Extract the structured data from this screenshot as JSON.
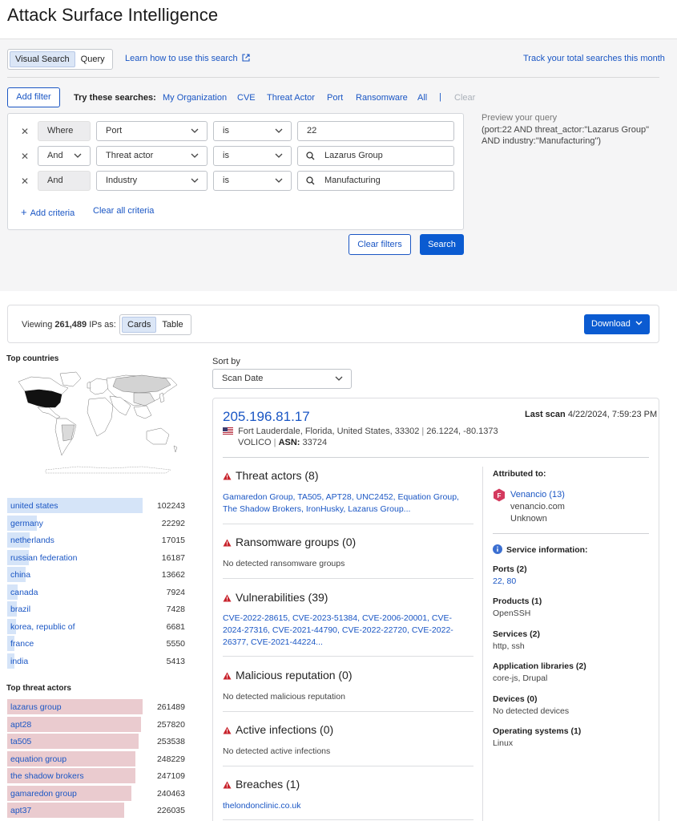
{
  "page": {
    "title": "Attack Surface Intelligence"
  },
  "search_mode": {
    "visual": "Visual Search",
    "query": "Query",
    "selected": "Visual Search"
  },
  "links": {
    "learn": "Learn how to use this search",
    "track": "Track your total searches this month"
  },
  "filters": {
    "add_filter": "Add filter",
    "try_label": "Try these searches:",
    "suggestions": [
      "My Organization",
      "CVE",
      "Threat Actor",
      "Port",
      "Ransomware",
      "All"
    ],
    "separator": "|",
    "clear": "Clear",
    "criteria": [
      {
        "connector": "Where",
        "field": "Port",
        "operator": "is",
        "value": "22"
      },
      {
        "connector": "And",
        "field": "Threat actor",
        "operator": "is",
        "value": "Lazarus Group"
      },
      {
        "connector": "And",
        "field": "Industry",
        "operator": "is",
        "value": "Manufacturing"
      }
    ],
    "add_criteria": "Add criteria",
    "clear_all_criteria": "Clear all criteria",
    "clear_filters": "Clear filters",
    "search": "Search"
  },
  "preview": {
    "label": "Preview your query",
    "query": "(port:22 AND threat_actor:\"Lazarus Group\" AND industry:\"Manufacturing\")"
  },
  "results": {
    "viewing_prefix": "Viewing",
    "count": "261,489",
    "viewing_suffix": "IPs as:",
    "views": [
      "Cards",
      "Table"
    ],
    "selected_view": "Cards",
    "download": "Download"
  },
  "top_countries": {
    "title": "Top countries",
    "max": 102243,
    "bar_color": "#d5e4f8",
    "items": [
      {
        "label": "united states",
        "value": 102243
      },
      {
        "label": "germany",
        "value": 22292
      },
      {
        "label": "netherlands",
        "value": 17015
      },
      {
        "label": "russian federation",
        "value": 16187
      },
      {
        "label": "china",
        "value": 13662
      },
      {
        "label": "canada",
        "value": 7924
      },
      {
        "label": "brazil",
        "value": 7428
      },
      {
        "label": "korea, republic of",
        "value": 6681
      },
      {
        "label": "france",
        "value": 5550
      },
      {
        "label": "india",
        "value": 5413
      }
    ]
  },
  "top_threat_actors": {
    "title": "Top threat actors",
    "max": 261489,
    "bar_color": "#eacbcf",
    "items": [
      {
        "label": "lazarus group",
        "value": 261489
      },
      {
        "label": "apt28",
        "value": 257820
      },
      {
        "label": "ta505",
        "value": 253538
      },
      {
        "label": "equation group",
        "value": 248229
      },
      {
        "label": "the shadow brokers",
        "value": 247109
      },
      {
        "label": "gamaredon group",
        "value": 240463
      },
      {
        "label": "apt37",
        "value": 226035
      }
    ]
  },
  "sort": {
    "label": "Sort by",
    "value": "Scan Date"
  },
  "card": {
    "ip": "205.196.81.17",
    "last_scan_label": "Last scan",
    "last_scan_value": "4/22/2024, 7:59:23 PM",
    "location": "Fort Lauderdale, Florida, United States, 33302",
    "coordinates": "26.1224, -80.1373",
    "org": "VOLICO",
    "asn_label": "ASN:",
    "asn": "33724",
    "sections": [
      {
        "title": "Threat actors (8)",
        "type": "link",
        "body": "Gamaredon Group, TA505, APT28, UNC2452, Equation Group, The Shadow Brokers, IronHusky, Lazarus Group..."
      },
      {
        "title": "Ransomware groups (0)",
        "type": "plain",
        "body": "No detected ransomware groups"
      },
      {
        "title": "Vulnerabilities (39)",
        "type": "link",
        "body": "CVE-2022-28615, CVE-2023-51384, CVE-2006-20001, CVE-2024-27316, CVE-2021-44790, CVE-2022-22720, CVE-2022-26377, CVE-2021-44224..."
      },
      {
        "title": "Malicious reputation (0)",
        "type": "plain",
        "body": "No detected malicious reputation"
      },
      {
        "title": "Active infections (0)",
        "type": "plain",
        "body": "No detected active infections"
      },
      {
        "title": "Breaches (1)",
        "type": "link",
        "body": "thelondonclinic.co.uk"
      }
    ],
    "attributed": {
      "title": "Attributed to:",
      "badge": "F",
      "name": "Venancio (13)",
      "domain": "venancio.com",
      "status": "Unknown"
    },
    "service": {
      "title": "Service information:",
      "items": [
        {
          "label": "Ports (2)",
          "value": "22, 80",
          "link": true
        },
        {
          "label": "Products (1)",
          "value": "OpenSSH",
          "link": false
        },
        {
          "label": "Services (2)",
          "value": "http, ssh",
          "link": false
        },
        {
          "label": "Application libraries (2)",
          "value": "core-js, Drupal",
          "link": false
        },
        {
          "label": "Devices (0)",
          "value": "No detected devices",
          "link": false
        },
        {
          "label": "Operating systems (1)",
          "value": "Linux",
          "link": false
        }
      ]
    }
  },
  "colors": {
    "accent": "#1a56c4",
    "primary_button": "#0b5bd1",
    "warning": "#c8232c",
    "attribution_badge": "#d43a5e",
    "info": "#3b6fd1"
  }
}
